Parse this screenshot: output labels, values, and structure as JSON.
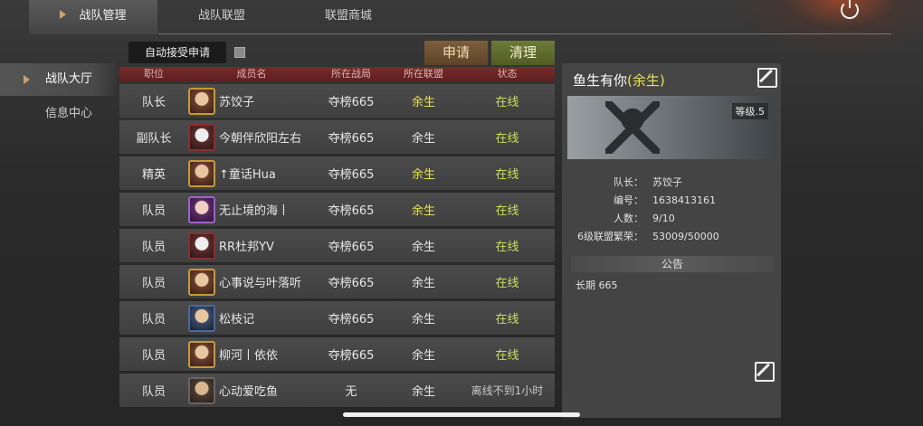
{
  "top_tabs": [
    {
      "label": "战队管理",
      "active": true
    },
    {
      "label": "战队联盟",
      "active": false
    },
    {
      "label": "联盟商城",
      "active": false
    }
  ],
  "side_nav": [
    {
      "label": "战队大厅",
      "active": true
    },
    {
      "label": "信息中心",
      "active": false
    }
  ],
  "toolbar": {
    "auto_accept_label": "自动接受申请",
    "auto_accept_checked": false,
    "apply_label": "申请",
    "clear_label": "清理"
  },
  "table": {
    "headers": {
      "position": "职位",
      "name": "成员名",
      "zone": "所在战局",
      "alliance": "所在联盟",
      "status": "状态"
    },
    "rows": [
      {
        "position": "队长",
        "name": "苏饺子",
        "zone": "夺榜665",
        "alliance": "余生",
        "status": "在线"
      },
      {
        "position": "副队长",
        "name": "今朝伴欣阳左右",
        "zone": "夺榜665",
        "alliance": "余生",
        "status": "在线"
      },
      {
        "position": "精英",
        "name": "↑童话Hua",
        "zone": "夺榜665",
        "alliance": "余生",
        "status": "在线"
      },
      {
        "position": "队员",
        "name": "无止境的海丨",
        "zone": "夺榜665",
        "alliance": "余生",
        "status": "在线"
      },
      {
        "position": "队员",
        "name": "RR杜邦YV",
        "zone": "夺榜665",
        "alliance": "余生",
        "status": "在线"
      },
      {
        "position": "队员",
        "name": "心事说与叶落听",
        "zone": "夺榜665",
        "alliance": "余生",
        "status": "在线"
      },
      {
        "position": "队员",
        "name": "松枝记",
        "zone": "夺榜665",
        "alliance": "余生",
        "status": "在线"
      },
      {
        "position": "队员",
        "name": "柳河丨依依",
        "zone": "夺榜665",
        "alliance": "余生",
        "status": "在线"
      },
      {
        "position": "队员",
        "name": "心动爱吃鱼",
        "zone": "无",
        "alliance": "余生",
        "status": "离线不到1小时"
      }
    ]
  },
  "team_panel": {
    "team_name": "鱼生有你",
    "alliance_tag": "(余生)",
    "level": "等级.5",
    "info": [
      {
        "key": "队长：",
        "value": "苏饺子"
      },
      {
        "key": "编号：",
        "value": "1638413161"
      },
      {
        "key": "人数：",
        "value": "9/10"
      },
      {
        "key": "6级联盟繁荣：",
        "value": "53009/50000"
      }
    ],
    "notice_title": "公告",
    "notice_text": "长期 665"
  },
  "colors": {
    "accent_gold": "#c9a36a",
    "online": "#c8e05a",
    "alliance_yellow": "#e8e05a",
    "header_red": "#7a2a2a"
  }
}
